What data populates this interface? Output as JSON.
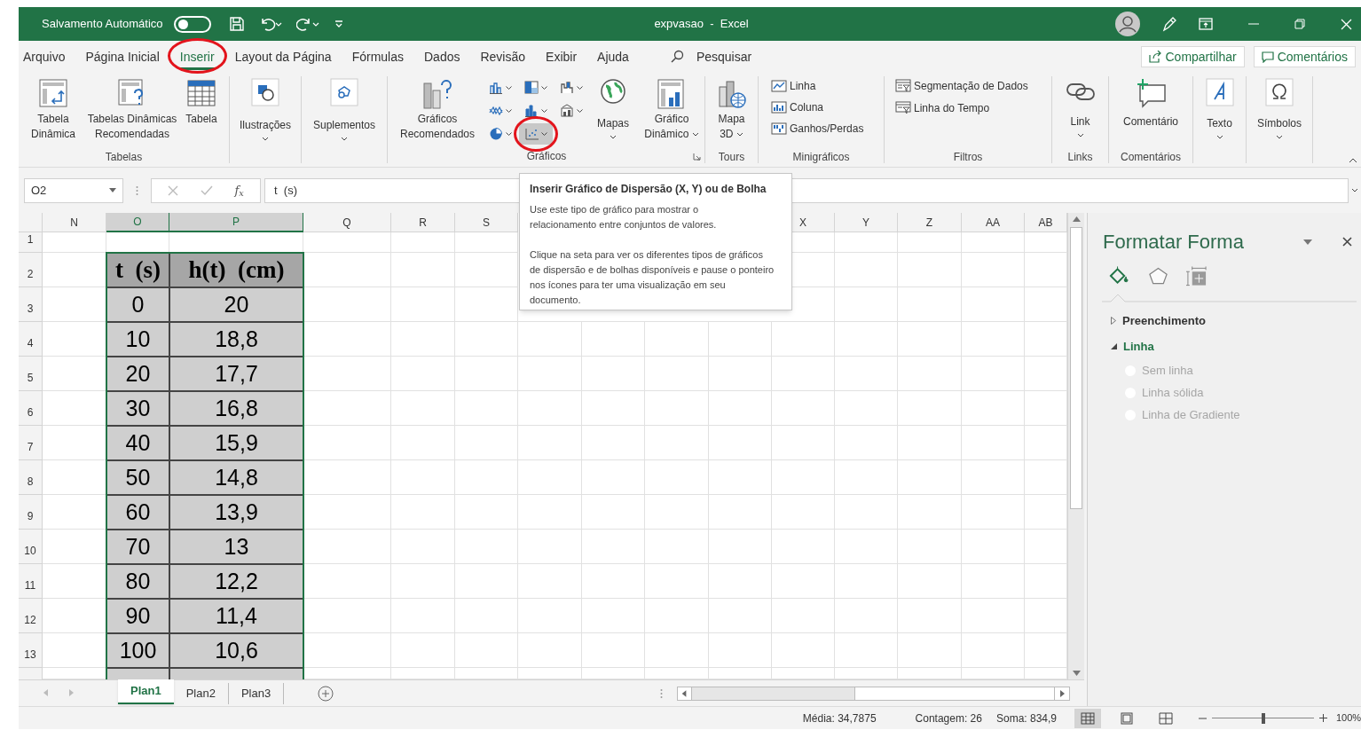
{
  "title_bar": {
    "autosave_label": "Salvamento Automático",
    "autosave_on": false,
    "title": "expvasao  -  Excel"
  },
  "tabs": [
    {
      "label": "Arquivo",
      "selected": false,
      "circled": false
    },
    {
      "label": "Página Inicial",
      "selected": false,
      "circled": false
    },
    {
      "label": "Inserir",
      "selected": true,
      "circled": true
    },
    {
      "label": "Layout da Página",
      "selected": false,
      "circled": false
    },
    {
      "label": "Fórmulas",
      "selected": false,
      "circled": false
    },
    {
      "label": "Dados",
      "selected": false,
      "circled": false
    },
    {
      "label": "Revisão",
      "selected": false,
      "circled": false
    },
    {
      "label": "Exibir",
      "selected": false,
      "circled": false
    },
    {
      "label": "Ajuda",
      "selected": false,
      "circled": false
    }
  ],
  "search": {
    "placeholder": "Pesquisar"
  },
  "share_button": "Compartilhar",
  "comments_button": "Comentários",
  "ribbon": {
    "tabelas": {
      "label": "Tabelas",
      "buttons": [
        "Tabela Dinâmica",
        "Tabelas Dinâmicas Recomendadas",
        "Tabela"
      ]
    },
    "ilustracoes": {
      "button": "Ilustrações"
    },
    "suplementos": {
      "button": "Suplementos"
    },
    "graficos": {
      "label": "Gráficos",
      "recommended": "Gráficos Recomendados",
      "maps": "Mapas",
      "pivot_chart": "Gráfico Dinâmico",
      "chart_buttons": [
        {
          "pressed": false,
          "circled": false
        },
        {
          "pressed": false,
          "circled": false
        },
        {
          "pressed": false,
          "circled": false
        },
        {
          "pressed": false,
          "circled": false
        },
        {
          "pressed": false,
          "circled": false
        },
        {
          "pressed": false,
          "circled": false
        },
        {
          "pressed": false,
          "circled": false
        },
        {
          "pressed": true,
          "circled": true
        }
      ]
    },
    "tours": {
      "label": "Tours",
      "button": "Mapa 3D"
    },
    "minigraficos": {
      "label": "Minigráficos",
      "buttons": [
        "Linha",
        "Coluna",
        "Ganhos/Perdas"
      ]
    },
    "filtros": {
      "label": "Filtros",
      "buttons": [
        "Segmentação de Dados",
        "Linha do Tempo"
      ]
    },
    "links": {
      "label": "Links",
      "button": "Link"
    },
    "comentarios": {
      "label": "Comentários",
      "button": "Comentário"
    },
    "texto": {
      "button": "Texto"
    },
    "simbolos": {
      "button": "Símbolos"
    }
  },
  "tooltip": {
    "title": "Inserir Gráfico de Dispersão (X, Y) ou de Bolha",
    "paragraphs": [
      "Use este tipo de gráfico para mostrar o relacionamento entre conjuntos de valores.",
      "Clique na seta para ver os diferentes tipos de gráficos de dispersão e de bolhas disponíveis e pause o ponteiro nos ícones para ter uma visualização em seu documento."
    ]
  },
  "formula_bar": {
    "name_box": "O2",
    "function_icon": "f$_{x}$",
    "formula": "t  (s)"
  },
  "grid": {
    "columns": [
      {
        "label": "N",
        "selected": false
      },
      {
        "label": "O",
        "selected": true
      },
      {
        "label": "P",
        "selected": true
      },
      {
        "label": "Q",
        "selected": false
      },
      {
        "label": "R",
        "selected": false
      },
      {
        "label": "S",
        "selected": false
      },
      {
        "label": "X",
        "selected": false
      },
      {
        "label": "Y",
        "selected": false
      },
      {
        "label": "Z",
        "selected": false
      },
      {
        "label": "AA",
        "selected": false
      },
      {
        "label": "AB",
        "selected": false
      }
    ],
    "rows": [
      "1",
      "2",
      "3",
      "4",
      "5",
      "6",
      "7",
      "8",
      "9",
      "10",
      "11",
      "12",
      "13"
    ],
    "table": {
      "header": [
        "t  (s)",
        "h(t)  (cm)"
      ],
      "rows": [
        [
          "0",
          "20"
        ],
        [
          "10",
          "18,8"
        ],
        [
          "20",
          "17,7"
        ],
        [
          "30",
          "16,8"
        ],
        [
          "40",
          "15,9"
        ],
        [
          "50",
          "14,8"
        ],
        [
          "60",
          "13,9"
        ],
        [
          "70",
          "13"
        ],
        [
          "80",
          "12,2"
        ],
        [
          "90",
          "11,4"
        ],
        [
          "100",
          "10,6"
        ]
      ]
    }
  },
  "sheet_tabs": [
    {
      "label": "Plan1",
      "selected": true
    },
    {
      "label": "Plan2",
      "selected": false
    },
    {
      "label": "Plan3",
      "selected": false
    }
  ],
  "status_bar": {
    "average": "Média: 34,7875",
    "count": "Contagem: 26",
    "sum": "Soma: 834,9",
    "views": [
      {
        "selected": true
      },
      {
        "selected": false
      },
      {
        "selected": false
      }
    ],
    "zoom_slider": {
      "level": 0.5
    },
    "zoom": "100%"
  },
  "format_pane": {
    "title": "Formatar Forma",
    "icon_tabs": [
      {
        "selected": true
      },
      {
        "selected": false
      },
      {
        "selected": false
      }
    ],
    "sections": [
      {
        "label": "Preenchimento",
        "expanded": false
      },
      {
        "label": "Linha",
        "expanded": true,
        "options": [
          {
            "label": "Sem linha",
            "checked": false,
            "disabled": true
          },
          {
            "label": "Linha sólida",
            "checked": false,
            "disabled": true
          },
          {
            "label": "Linha de Gradiente",
            "checked": false,
            "disabled": true
          }
        ]
      }
    ]
  }
}
